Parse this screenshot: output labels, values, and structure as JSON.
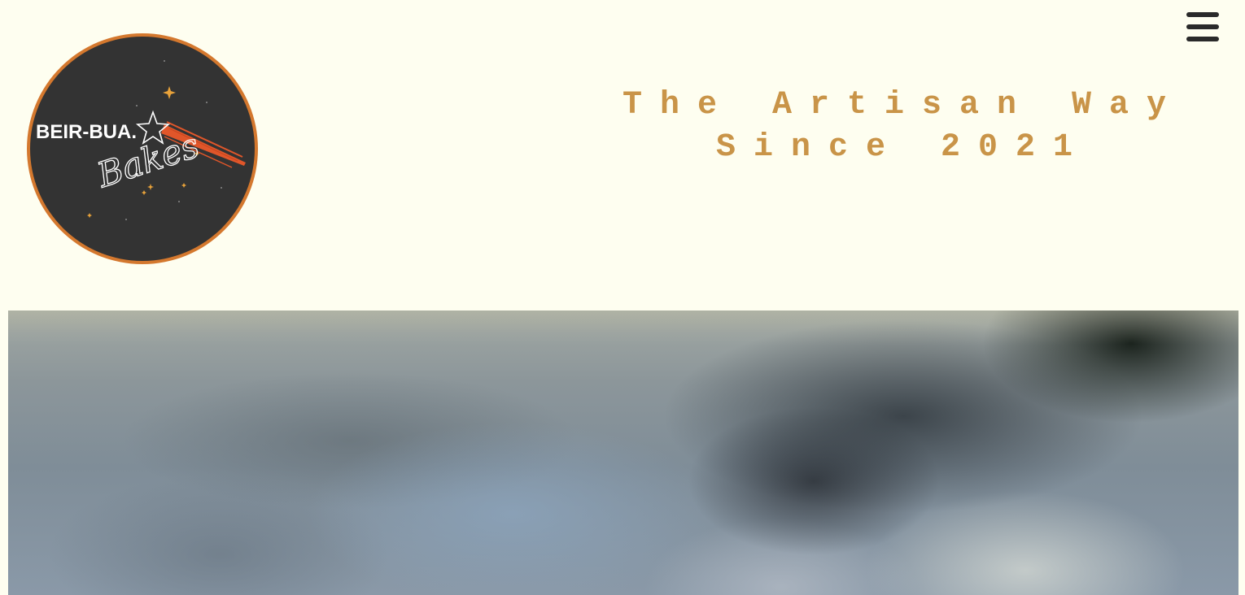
{
  "header": {
    "menu_icon": "hamburger-menu-icon",
    "logo": {
      "line1": "BEIR-BUA.",
      "line2": "Bakes",
      "colors": {
        "background": "#333333",
        "ring": "#d4782e",
        "comet": "#e0562a",
        "stars": "#e8a23a",
        "text": "#ffffff"
      }
    },
    "tagline": {
      "line1": "The Artisan Way",
      "line2": "Since 2021",
      "color": "#c99448"
    }
  },
  "hero": {
    "description_icon": "hero-photo-image"
  },
  "colors": {
    "page_background": "#fefef0",
    "menu_icon": "#2a2a2a"
  }
}
